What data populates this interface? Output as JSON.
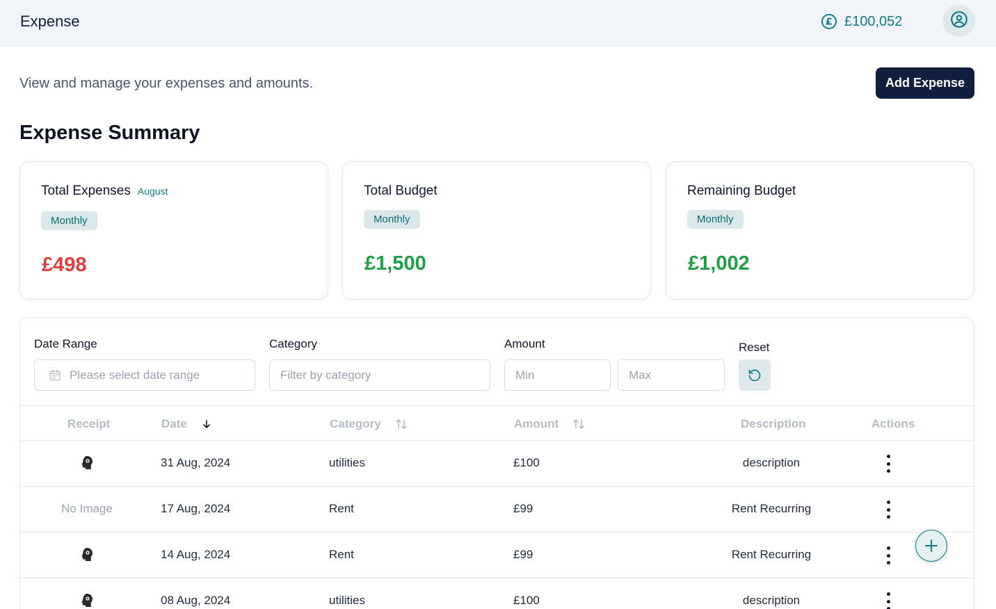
{
  "header": {
    "title": "Expense",
    "balance": "£100,052",
    "balance_icon": "pound-coin-icon",
    "avatar_icon": "user-circle-icon"
  },
  "intro": {
    "description": "View and manage your expenses and amounts.",
    "add_button": "Add Expense"
  },
  "summary": {
    "title": "Expense Summary",
    "cards": [
      {
        "title": "Total Expenses",
        "subtitle": "August",
        "badge": "Monthly",
        "value": "£498",
        "value_color": "#e03e3e"
      },
      {
        "title": "Total Budget",
        "subtitle": "",
        "badge": "Monthly",
        "value": "£1,500",
        "value_color": "#1e9e45"
      },
      {
        "title": "Remaining Budget",
        "subtitle": "",
        "badge": "Monthly",
        "value": "£1,002",
        "value_color": "#1e9e45"
      }
    ]
  },
  "filters": {
    "date_range": {
      "label": "Date Range",
      "placeholder": "Please select date range"
    },
    "category": {
      "label": "Category",
      "placeholder": "Filter by category"
    },
    "amount": {
      "label": "Amount",
      "min_placeholder": "Min",
      "max_placeholder": "Max"
    },
    "reset": {
      "label": "Reset",
      "icon": "reset-icon"
    }
  },
  "table": {
    "columns": {
      "receipt": "Receipt",
      "date": "Date",
      "category": "Category",
      "amount": "Amount",
      "description": "Description",
      "actions": "Actions"
    },
    "rows": [
      {
        "receipt": "",
        "has_image": true,
        "date": "31 Aug, 2024",
        "category": "utilities",
        "amount": "£100",
        "description": "description"
      },
      {
        "receipt": "No Image",
        "has_image": false,
        "date": "17 Aug, 2024",
        "category": "Rent",
        "amount": "£99",
        "description": "Rent Recurring"
      },
      {
        "receipt": "",
        "has_image": true,
        "date": "14 Aug, 2024",
        "category": "Rent",
        "amount": "£99",
        "description": "Rent Recurring"
      },
      {
        "receipt": "",
        "has_image": true,
        "date": "08 Aug, 2024",
        "category": "utilities",
        "amount": "£100",
        "description": "description"
      }
    ]
  },
  "colors": {
    "primary": "#0f1f3d",
    "accent": "#0e7c86",
    "danger": "#e03e3e",
    "success": "#1e9e45"
  }
}
